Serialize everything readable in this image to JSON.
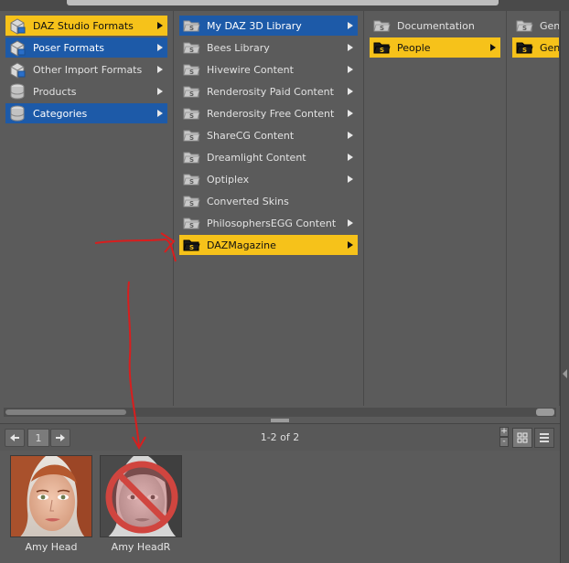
{
  "columns": {
    "col1": [
      {
        "label": "DAZ Studio Formats",
        "icon": "daz-studio-formats-icon",
        "state": "gold",
        "arrow": true
      },
      {
        "label": "Poser Formats",
        "icon": "poser-formats-icon",
        "state": "blue",
        "arrow": true
      },
      {
        "label": "Other Import Formats",
        "icon": "other-import-formats-icon",
        "state": "",
        "arrow": true
      },
      {
        "label": "Products",
        "icon": "products-database-icon",
        "state": "",
        "arrow": true
      },
      {
        "label": "Categories",
        "icon": "categories-database-icon",
        "state": "blue",
        "arrow": true
      }
    ],
    "col2": [
      {
        "label": "My DAZ 3D Library",
        "state": "blue",
        "arrow": true
      },
      {
        "label": "Bees Library",
        "state": "",
        "arrow": true
      },
      {
        "label": "Hivewire Content",
        "state": "",
        "arrow": true
      },
      {
        "label": "Renderosity Paid Content",
        "state": "",
        "arrow": true
      },
      {
        "label": "Renderosity Free Content",
        "state": "",
        "arrow": true
      },
      {
        "label": "ShareCG Content",
        "state": "",
        "arrow": true
      },
      {
        "label": "Dreamlight Content",
        "state": "",
        "arrow": true
      },
      {
        "label": "Optiplex",
        "state": "",
        "arrow": true
      },
      {
        "label": "Converted Skins",
        "state": "",
        "arrow": false
      },
      {
        "label": "PhilosophersEGG Content",
        "state": "",
        "arrow": true
      },
      {
        "label": "DAZMagazine",
        "state": "gold",
        "arrow": true
      }
    ],
    "col3": [
      {
        "label": "Documentation",
        "state": "",
        "arrow": false
      },
      {
        "label": "People",
        "state": "gold",
        "arrow": true
      }
    ],
    "col4": [
      {
        "label": "Gen",
        "state": "",
        "arrow": false
      },
      {
        "label": "Gen",
        "state": "gold",
        "arrow": false
      }
    ]
  },
  "pager": {
    "prev_icon": "arrow-left-icon",
    "page": "1",
    "next_icon": "arrow-right-icon",
    "count": "1-2 of 2",
    "zoom_in": "+",
    "zoom_out": "-"
  },
  "thumbnails": [
    {
      "caption": "Amy Head",
      "style": "color"
    },
    {
      "caption": "Amy HeadR",
      "style": "grayscale-crossed"
    }
  ],
  "colors": {
    "gold": "#f6c21a",
    "blue": "#1d5aa8",
    "annotation_red": "#d81e1e"
  }
}
